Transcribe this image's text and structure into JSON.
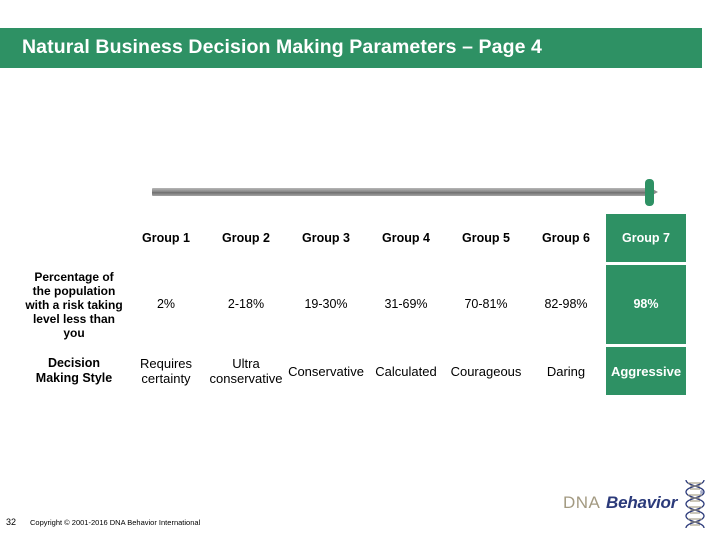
{
  "slide": {
    "title": "Natural Business Decision Making Parameters – Page 4",
    "accent_color": "#2e9164",
    "bar_color": "#8a8a8a"
  },
  "slider": {
    "marker_label": "risk-position-marker",
    "marker_color": "#2e9164"
  },
  "table": {
    "row_labels": {
      "groups": "",
      "percentage": "Percentage of the population with a risk taking level less than you",
      "style": "Decision Making Style"
    },
    "groups": [
      "Group 1",
      "Group 2",
      "Group 3",
      "Group 4",
      "Group 5",
      "Group 6",
      "Group 7"
    ],
    "percentages": [
      "2%",
      "2-18%",
      "19-30%",
      "31-69%",
      "70-81%",
      "82-98%",
      "98%"
    ],
    "styles": [
      "Requires certainty",
      "Ultra conservative",
      "Conservative",
      "Calculated",
      "Courageous",
      "Daring",
      "Aggressive"
    ],
    "highlighted_index": 6
  },
  "footer": {
    "page_number": "32",
    "copyright": "Copyright © 2001-2016 DNA Behavior International"
  },
  "logo": {
    "word_one": "DNA",
    "word_two": "Behavior",
    "trademark": "®"
  }
}
